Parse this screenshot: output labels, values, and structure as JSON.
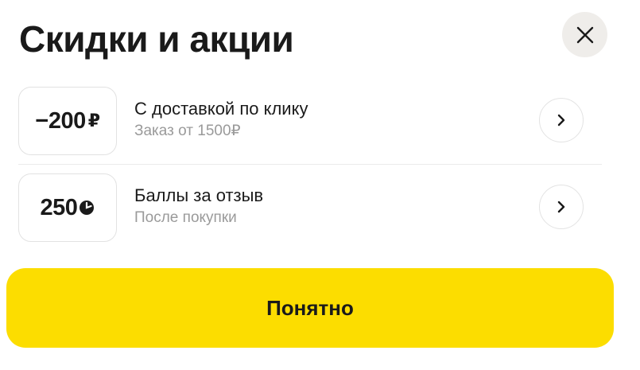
{
  "header": {
    "title": "Скидки и акции",
    "close_icon": "close-icon"
  },
  "promos": [
    {
      "badge_value": "−200",
      "badge_unit": "₽",
      "title": "С доставкой по клику",
      "subtitle": "Заказ от 1500₽",
      "action_icon": "chevron-right-icon"
    },
    {
      "badge_value": "250",
      "badge_unit_icon": "points-icon",
      "title": "Баллы за отзыв",
      "subtitle": "После покупки",
      "action_icon": "chevron-right-icon"
    }
  ],
  "footer": {
    "confirm_label": "Понятно"
  },
  "colors": {
    "accent": "#fcdd00",
    "close_bg": "#efedea",
    "text": "#1a1a1a",
    "muted": "#9a9a9a"
  }
}
